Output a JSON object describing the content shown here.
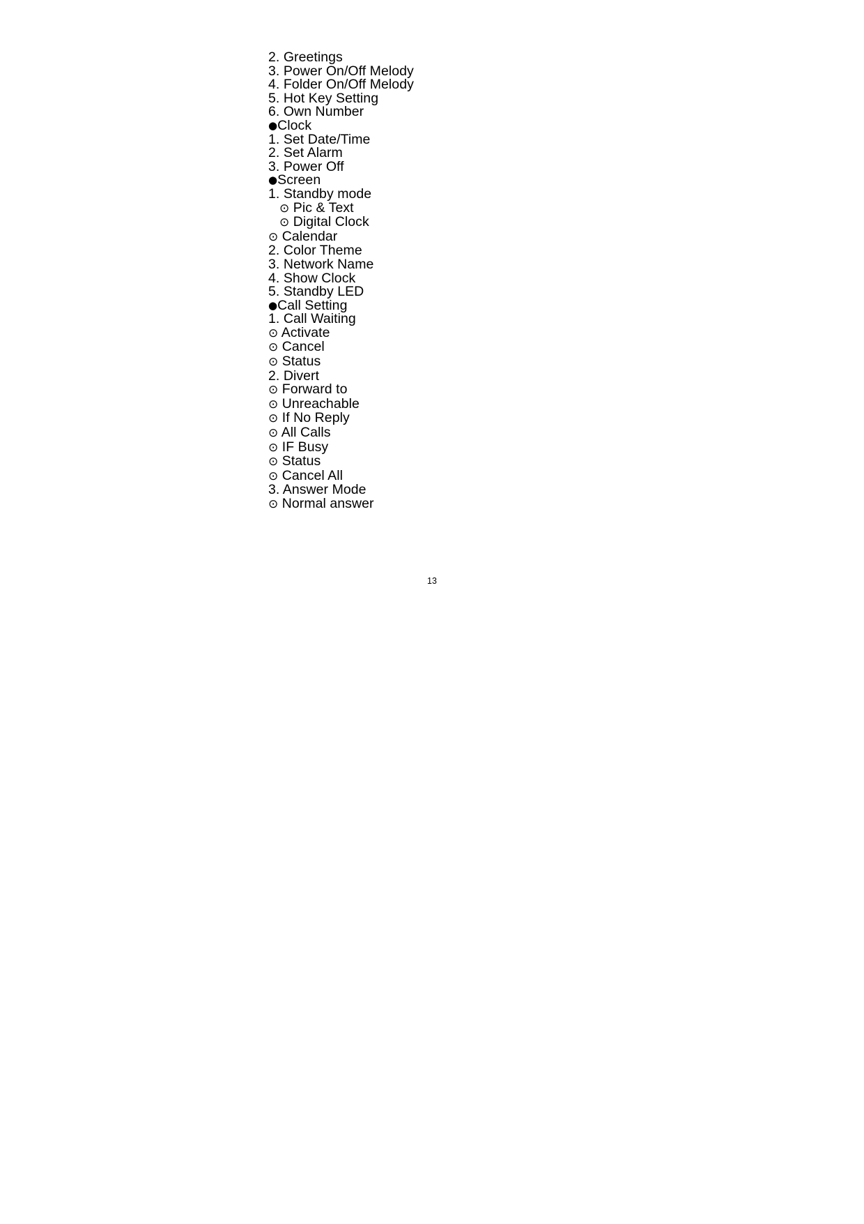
{
  "document": {
    "page_number": "13",
    "markers": {
      "section": "●",
      "option": "⊙"
    },
    "lines": [
      {
        "type": "numbered",
        "number": "2.",
        "label": "Greetings",
        "indent": 0
      },
      {
        "type": "numbered",
        "number": "3.",
        "label": "Power On/Off Melody",
        "indent": 0
      },
      {
        "type": "numbered",
        "number": "4.",
        "label": "Folder On/Off Melody",
        "indent": 0
      },
      {
        "type": "numbered",
        "number": "5.",
        "label": "Hot Key Setting",
        "indent": 0
      },
      {
        "type": "numbered",
        "number": "6.",
        "label": "Own Number",
        "indent": 0
      },
      {
        "type": "section",
        "label": "Clock",
        "indent": 0
      },
      {
        "type": "numbered",
        "number": "1.",
        "label": "Set Date/Time",
        "indent": 0
      },
      {
        "type": "numbered",
        "number": "2.",
        "label": "Set Alarm",
        "indent": 0
      },
      {
        "type": "numbered",
        "number": "3.",
        "label": "Power Off",
        "indent": 0
      },
      {
        "type": "section",
        "label": "Screen",
        "indent": 0
      },
      {
        "type": "numbered",
        "number": "1.",
        "label": "Standby mode",
        "indent": 0
      },
      {
        "type": "option",
        "label": "Pic & Text",
        "indent": 1
      },
      {
        "type": "option",
        "label": "Digital Clock",
        "indent": 1
      },
      {
        "type": "option",
        "label": "Calendar",
        "indent": 0
      },
      {
        "type": "numbered",
        "number": "2.",
        "label": "Color Theme",
        "indent": 0
      },
      {
        "type": "numbered",
        "number": "3.",
        "label": "Network Name",
        "indent": 0
      },
      {
        "type": "numbered",
        "number": "4.",
        "label": "Show Clock",
        "indent": 0
      },
      {
        "type": "numbered",
        "number": "5.",
        "label": "Standby LED",
        "indent": 0
      },
      {
        "type": "section",
        "label": "Call Setting",
        "indent": 0
      },
      {
        "type": "numbered",
        "number": "1.",
        "label": "Call Waiting",
        "indent": 0
      },
      {
        "type": "option",
        "label": "Activate",
        "indent": 0
      },
      {
        "type": "option",
        "label": "Cancel",
        "indent": 0
      },
      {
        "type": "option",
        "label": "Status",
        "indent": 0
      },
      {
        "type": "numbered",
        "number": "2.",
        "label": "Divert",
        "indent": 0
      },
      {
        "type": "option",
        "label": "Forward to",
        "indent": 0
      },
      {
        "type": "option",
        "label": "Unreachable",
        "indent": 0
      },
      {
        "type": "option",
        "label": "If No Reply",
        "indent": 0
      },
      {
        "type": "option",
        "label": "All Calls",
        "indent": 0
      },
      {
        "type": "option",
        "label": "IF Busy",
        "indent": 0
      },
      {
        "type": "option",
        "label": "Status",
        "indent": 0
      },
      {
        "type": "option",
        "label": "Cancel All",
        "indent": 0
      },
      {
        "type": "numbered",
        "number": "3.",
        "label": "Answer Mode",
        "indent": 0
      },
      {
        "type": "option",
        "label": "Normal answer",
        "indent": 0
      }
    ]
  }
}
